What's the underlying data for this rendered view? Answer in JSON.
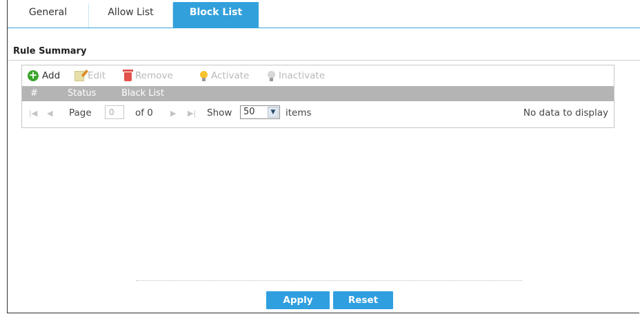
{
  "tabs": [
    {
      "label": "General",
      "active": false
    },
    {
      "label": "Allow List",
      "active": false
    },
    {
      "label": "Block List",
      "active": true
    }
  ],
  "section": {
    "title": "Rule Summary"
  },
  "toolbar": {
    "add": "Add",
    "edit": "Edit",
    "remove": "Remove",
    "activate": "Activate",
    "inactivate": "Inactivate"
  },
  "table": {
    "columns": [
      "#",
      "Status",
      "Black List"
    ],
    "rows": []
  },
  "pager": {
    "page_label": "Page",
    "page_value": "0",
    "of_label": "of 0",
    "show_label": "Show",
    "show_value": "50",
    "items_label": "items",
    "empty_text": "No data to display"
  },
  "buttons": {
    "apply": "Apply",
    "reset": "Reset"
  },
  "colors": {
    "accent": "#32a0db",
    "button": "#2f9fe0",
    "header": "#b4b4b4",
    "add_green": "#3aa52c"
  }
}
